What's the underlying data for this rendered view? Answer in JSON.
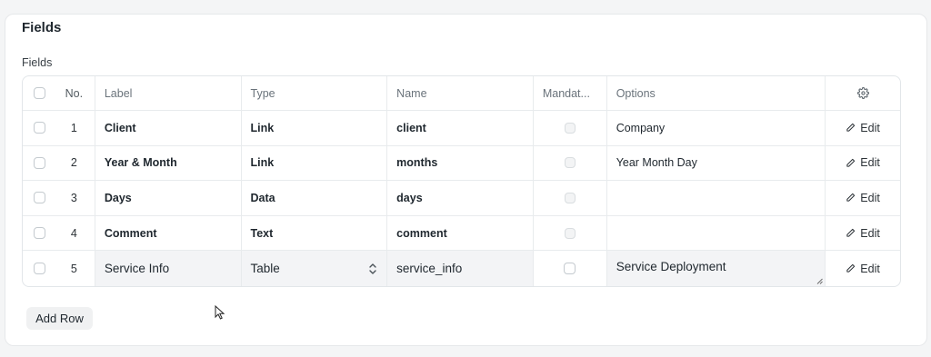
{
  "section": {
    "title": "Fields"
  },
  "grid": {
    "label": "Fields",
    "columns": {
      "no": "No.",
      "label": "Label",
      "type": "Type",
      "name": "Name",
      "mandatory": "Mandat...",
      "options": "Options",
      "settings_icon": "gear-icon"
    },
    "rows": [
      {
        "no": "1",
        "label": "Client",
        "type": "Link",
        "name": "client",
        "options": "Company",
        "edit": "Edit"
      },
      {
        "no": "2",
        "label": "Year & Month",
        "type": "Link",
        "name": "months",
        "options": "Year Month Day",
        "edit": "Edit"
      },
      {
        "no": "3",
        "label": "Days",
        "type": "Data",
        "name": "days",
        "options": "",
        "edit": "Edit"
      },
      {
        "no": "4",
        "label": "Comment",
        "type": "Text",
        "name": "comment",
        "options": "",
        "edit": "Edit"
      },
      {
        "no": "5",
        "label": "Service Info",
        "type": "Table",
        "name": "service_info",
        "options": "Service Deployment",
        "edit": "Edit"
      }
    ]
  },
  "add_row": {
    "label": "Add Row"
  }
}
